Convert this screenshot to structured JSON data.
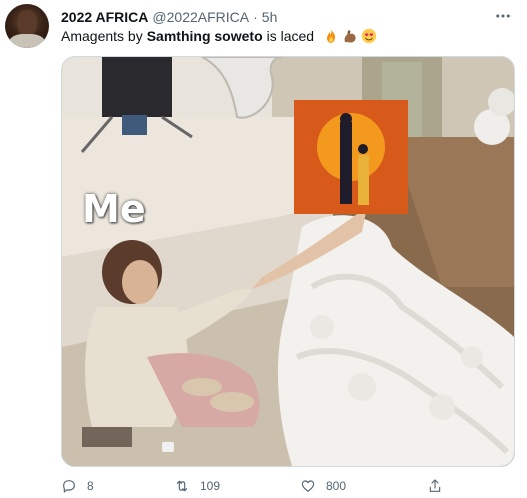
{
  "tweet": {
    "display_name": "2022 AFRICA",
    "handle": "@2022AFRICA",
    "separator": "·",
    "time": "5h",
    "text_before": "Amagents by",
    "text_bold": "Samthing soweto",
    "text_after": "is laced",
    "emojis": [
      "fire-emoji",
      "flexed-biceps-emoji",
      "smiling-face-with-heart-eyes-emoji"
    ],
    "media_caption": "Me",
    "stats": {
      "replies": "8",
      "retweets": "109",
      "likes": "800"
    }
  },
  "colors": {
    "text": "#0f1419",
    "secondary": "#536471",
    "border": "#cfd9de",
    "album_orange": "#d85a1b"
  }
}
